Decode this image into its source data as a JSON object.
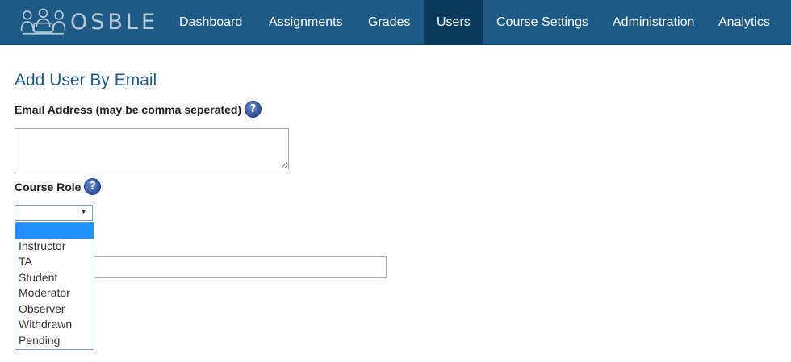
{
  "brand": {
    "name": "OSBLE"
  },
  "nav": {
    "items": [
      {
        "label": "Dashboard"
      },
      {
        "label": "Assignments"
      },
      {
        "label": "Grades"
      },
      {
        "label": "Users"
      },
      {
        "label": "Course Settings"
      },
      {
        "label": "Administration"
      },
      {
        "label": "Analytics"
      }
    ],
    "active": "Users"
  },
  "form": {
    "title": "Add User By Email",
    "email_label": "Email Address (may be comma seperated)",
    "email_value": "",
    "role_label": "Course Role",
    "help_icon_glyph": "?",
    "role_selected": "",
    "role_options": [
      "",
      "Instructor",
      "TA",
      "Student",
      "Moderator",
      "Observer",
      "Withdrawn",
      "Pending"
    ],
    "dropdown_arrow": "▼"
  },
  "colors": {
    "navbar": "#1d5b86",
    "nav_active": "#0b3a5c",
    "title": "#1d5b86",
    "highlight": "#1e90ff"
  },
  "icons": {
    "help": "help-icon",
    "logo": "osble-logo-icon"
  }
}
